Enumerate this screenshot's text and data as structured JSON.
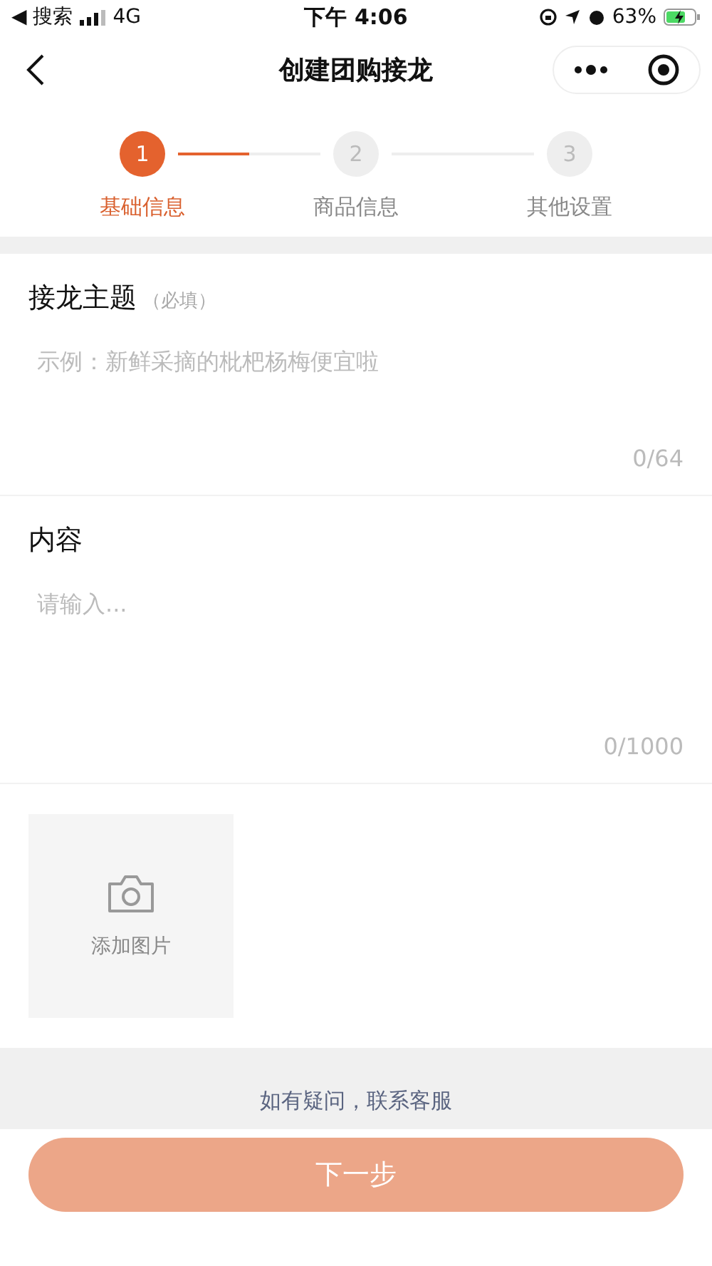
{
  "status_bar": {
    "back_app": "◀ 搜索",
    "network": "4G",
    "time": "下午 4:06",
    "battery": "63%"
  },
  "nav": {
    "title": "创建团购接龙"
  },
  "steps": [
    {
      "number": "1",
      "label": "基础信息",
      "selected": true
    },
    {
      "number": "2",
      "label": "商品信息",
      "selected": false
    },
    {
      "number": "3",
      "label": "其他设置",
      "selected": false
    }
  ],
  "fields": [
    {
      "label": "接龙主题",
      "hint": "（必填）",
      "placeholder": "示例：新鲜采摘的枇杷杨梅便宜啦",
      "counter": "0/64"
    },
    {
      "label": "内容",
      "placeholder": "请输入...",
      "counter": "0/1000"
    }
  ],
  "image_upload": {
    "label": "添加图片"
  },
  "help_link": "如有疑问，联系客服",
  "next_button": {
    "label": "下一步",
    "disabled": true
  }
}
